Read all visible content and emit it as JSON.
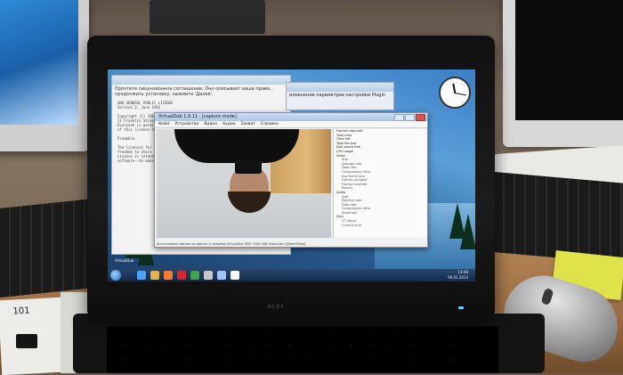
{
  "colors": {
    "screen_wallpaper": "#3b7fc8",
    "taskbar": "#1f3a60",
    "window_title": "#bcd0e6",
    "laptop_body": "#111111",
    "sticky_note": "#dfe34a"
  },
  "laptop": {
    "brand": "acer"
  },
  "desktop": {
    "license_window": {
      "header_line_1": "Прочтите лицензионное соглашение. Оно описывает ваши права...",
      "header_line_2": "продолжить установку, нажмите 'Далее'.",
      "body_lines": [
        "GNU GENERAL PUBLIC LICENSE",
        "Version 2, June 1991",
        "",
        "Copyright (C) 1989, 1991 Free Software Foundation, Inc.",
        "51 Franklin Street, Fifth Floor, Boston",
        "Everyone is permitted to copy and distribute",
        "of this license document, but changing it is not allowed.",
        "",
        "Preamble",
        "",
        "The licenses for most software are designed",
        "freedom to share and change it. By contrast,",
        "License is intended to guarantee your freedom",
        "software--to make sure the software is free"
      ]
    },
    "settings_window": {
      "title": "изменение параметров настройки Plugin"
    },
    "desktop_icon_label": "VirtualDub"
  },
  "vdub": {
    "title": "VirtualDub 1.9.11 - [capture mode]",
    "menu": [
      "Файл",
      "Устройство",
      "Видео",
      "Аудио",
      "Захват",
      "Справка"
    ],
    "status": "Accumulated capture  no capture in progress    VirtualDub  IEEE 1394  USB  VideoCam  [DirectShow]",
    "side_panel": [
      {
        "label": "Frames captured",
        "indent": false
      },
      {
        "label": "Total time",
        "indent": false
      },
      {
        "label": "Time left",
        "indent": false
      },
      {
        "label": "Total file size",
        "indent": false
      },
      {
        "label": "Disk space free",
        "indent": false
      },
      {
        "label": "CPU usage",
        "indent": false
      },
      {
        "label": "Video",
        "indent": false
      },
      {
        "label": "Size",
        "indent": true
      },
      {
        "label": "Average rate",
        "indent": true
      },
      {
        "label": "Data rate",
        "indent": true
      },
      {
        "label": "Compression ratio",
        "indent": true
      },
      {
        "label": "Avg frame size",
        "indent": true
      },
      {
        "label": "Frames dropped",
        "indent": true
      },
      {
        "label": "Frames inserted",
        "indent": true
      },
      {
        "label": "Resync",
        "indent": true
      },
      {
        "label": "Audio",
        "indent": false
      },
      {
        "label": "Size",
        "indent": true
      },
      {
        "label": "Relative rate",
        "indent": true
      },
      {
        "label": "Data rate",
        "indent": true
      },
      {
        "label": "Compression ratio",
        "indent": true
      },
      {
        "label": "Resample",
        "indent": true
      },
      {
        "label": "Sync",
        "indent": false
      },
      {
        "label": "VT adjust",
        "indent": true
      },
      {
        "label": "Current error",
        "indent": true
      }
    ]
  },
  "taskbar": {
    "time": "13:48",
    "date": "09.01.2013",
    "apps": [
      {
        "name": "start-orb",
        "color": "#2f8ae0"
      },
      {
        "name": "ie-icon",
        "color": "#4aa3ff"
      },
      {
        "name": "explorer-icon",
        "color": "#e2b34a"
      },
      {
        "name": "media-icon",
        "color": "#ff7b2c"
      },
      {
        "name": "opera-icon",
        "color": "#d8262f"
      },
      {
        "name": "chrome-icon",
        "color": "#3fa34d"
      },
      {
        "name": "app-icon",
        "color": "#c8c8c8"
      },
      {
        "name": "app-icon",
        "color": "#a0c4ff"
      },
      {
        "name": "app-icon",
        "color": "#ffffff"
      }
    ]
  },
  "paper_note": "101"
}
